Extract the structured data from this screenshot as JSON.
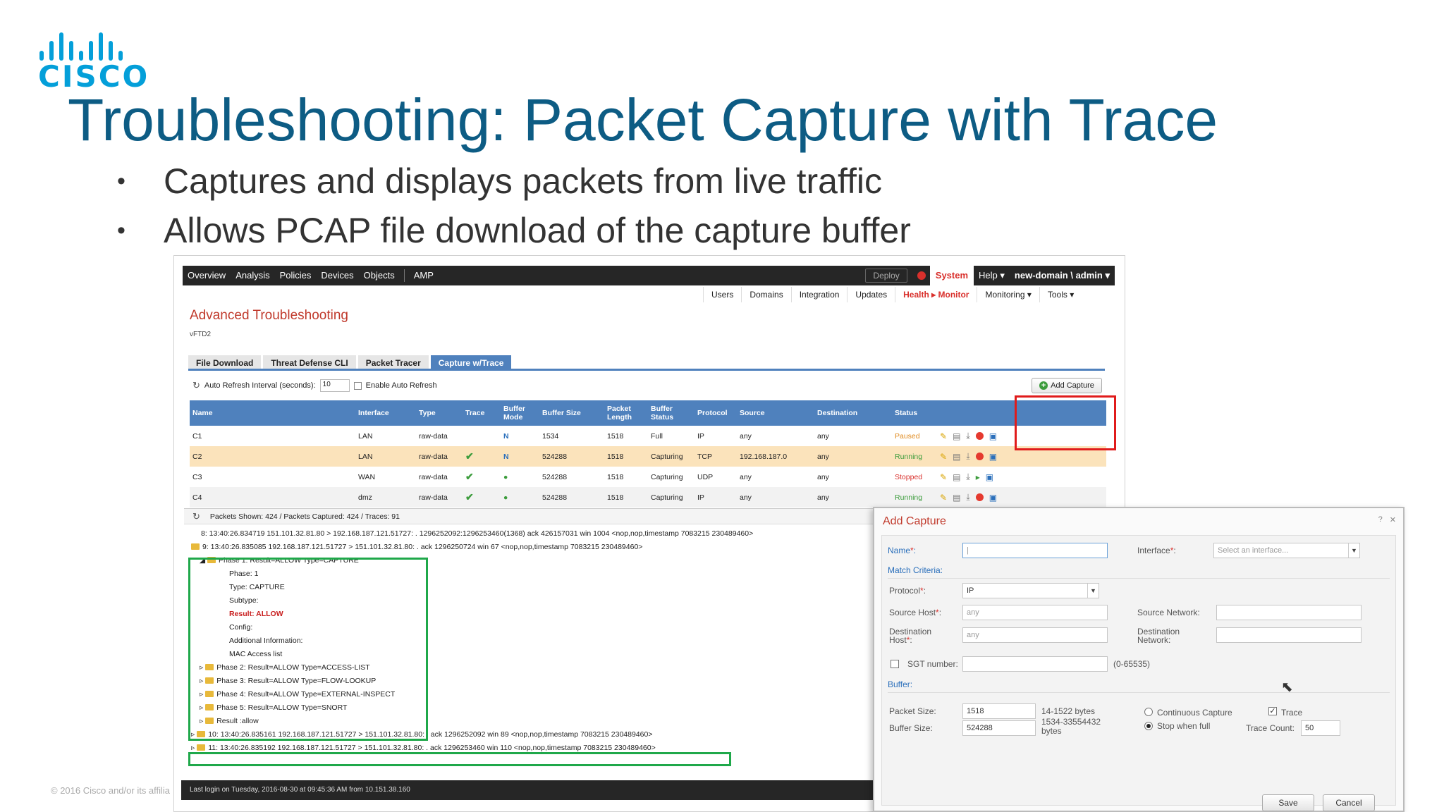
{
  "slide": {
    "logo_text": "CISCO",
    "title": "Troubleshooting: Packet Capture with Trace",
    "bullets": [
      "Captures and displays packets from live traffic",
      "Allows PCAP file download of the capture buffer"
    ],
    "copyright": "© 2016  Cisco and/or its affilia"
  },
  "topnav": {
    "items": [
      "Overview",
      "Analysis",
      "Policies",
      "Devices",
      "Objects",
      "AMP"
    ],
    "deploy": "Deploy",
    "system": "System",
    "help": "Help ▾",
    "user": "new-domain \\ admin ▾"
  },
  "subnav": {
    "items": [
      "Users",
      "Domains",
      "Integration",
      "Updates",
      "Health ▸ Monitor",
      "Monitoring ▾",
      "Tools ▾"
    ]
  },
  "page": {
    "heading": "Advanced Troubleshooting",
    "device": "vFTD2",
    "tabs": [
      "File Download",
      "Threat Defense CLI",
      "Packet Tracer",
      "Capture w/Trace"
    ],
    "auto_refresh_label": "Auto Refresh Interval (seconds):",
    "auto_refresh_value": "10",
    "enable_auto_refresh": "Enable Auto Refresh",
    "add_capture": "Add Capture"
  },
  "table": {
    "headers": [
      "Name",
      "Interface",
      "Type",
      "Trace",
      "Buffer Mode",
      "Buffer Size",
      "Packet Length",
      "Buffer Status",
      "Protocol",
      "Source",
      "Destination",
      "Status"
    ],
    "rows": [
      {
        "name": "C1",
        "iface": "LAN",
        "type": "raw-data",
        "trace": "",
        "size": "1534",
        "len": "1518",
        "bstatus": "Full",
        "proto": "IP",
        "src": "any",
        "dst": "any",
        "status": "Paused"
      },
      {
        "name": "C2",
        "iface": "LAN",
        "type": "raw-data",
        "trace": "✔",
        "size": "524288",
        "len": "1518",
        "bstatus": "Capturing",
        "proto": "TCP",
        "src": "192.168.187.0",
        "dst": "any",
        "status": "Running"
      },
      {
        "name": "C3",
        "iface": "WAN",
        "type": "raw-data",
        "trace": "✔",
        "size": "524288",
        "len": "1518",
        "bstatus": "Capturing",
        "proto": "UDP",
        "src": "any",
        "dst": "any",
        "status": "Stopped"
      },
      {
        "name": "C4",
        "iface": "dmz",
        "type": "raw-data",
        "trace": "✔",
        "size": "524288",
        "len": "1518",
        "bstatus": "Capturing",
        "proto": "IP",
        "src": "any",
        "dst": "any",
        "status": "Running"
      }
    ]
  },
  "trace": {
    "summary": "Packets Shown: 424 / Packets Captured: 424 / Traces: 91",
    "lines": [
      "8: 13:40:26.834719 151.101.32.81.80 > 192.168.187.121.51727: . 1296252092:1296253460(1368) ack 426157031 win 1004 <nop,nop,timestamp 7083215 230489460>",
      "9: 13:40:26.835085 192.168.187.121.51727 > 151.101.32.81.80: . ack 1296250724 win 67 <nop,nop,timestamp 7083215 230489460>",
      "Phase 1: Result=ALLOW Type=CAPTURE",
      "Phase: 1",
      "Type: CAPTURE",
      "Subtype:",
      "Result: ALLOW",
      "Config:",
      "Additional Information:",
      "MAC Access list",
      "Phase 2: Result=ALLOW Type=ACCESS-LIST",
      "Phase 3: Result=ALLOW Type=FLOW-LOOKUP",
      "Phase 4: Result=ALLOW Type=EXTERNAL-INSPECT",
      "Phase 5: Result=ALLOW Type=SNORT",
      "Result :allow",
      "10: 13:40:26.835161 192.168.187.121.51727 > 151.101.32.81.80: . ack 1296252092 win 89 <nop,nop,timestamp 7083215 230489460>",
      "11: 13:40:26.835192 192.168.187.121.51727 > 151.101.32.81.80: . ack 1296253460 win 110 <nop,nop,timestamp 7083215 230489460>"
    ],
    "last_login": "Last login on Tuesday, 2016-08-30 at 09:45:36 AM from 10.151.38.160"
  },
  "dialog": {
    "title": "Add Capture",
    "help": "?",
    "close": "✕",
    "name_label": "Name",
    "interface_label": "Interface",
    "interface_placeholder": "Select an interface...",
    "match_criteria": "Match Criteria:",
    "protocol_label": "Protocol",
    "protocol_value": "IP",
    "source_host_label": "Source Host",
    "source_host_value": "any",
    "source_network_label": "Source Network:",
    "dest_host_label": "Destination Host",
    "dest_host_value": "any",
    "dest_network_label": "Destination Network:",
    "sgt_label": "SGT number:",
    "sgt_range": "(0-65535)",
    "buffer": "Buffer:",
    "packet_size_label": "Packet Size:",
    "packet_size_value": "1518",
    "packet_size_range": "14-1522 bytes",
    "buffer_size_label": "Buffer Size:",
    "buffer_size_value": "524288",
    "buffer_size_range": "1534-33554432 bytes",
    "continuous_capture": "Continuous Capture",
    "stop_when_full": "Stop when full",
    "trace_label": "Trace",
    "trace_count_label": "Trace Count:",
    "trace_count_value": "50",
    "save": "Save",
    "cancel": "Cancel"
  }
}
